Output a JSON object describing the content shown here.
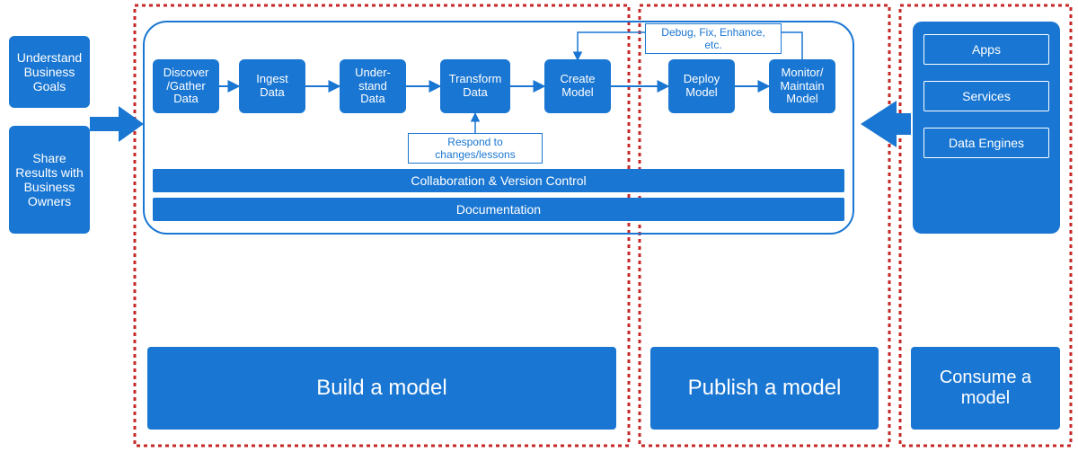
{
  "colors": {
    "primary": "#1976d2",
    "dashed": "#c62828"
  },
  "left": {
    "understand_goals": "Understand Business Goals",
    "share_results": "Share Results with Business Owners"
  },
  "process": {
    "steps": [
      "Discover /Gather Data",
      "Ingest Data",
      "Under-stand Data",
      "Transform Data",
      "Create Model",
      "Deploy Model",
      "Monitor/ Maintain Model"
    ],
    "feedback_top": "Debug, Fix, Enhance, etc.",
    "feedback_bottom": "Respond to changes/lessons"
  },
  "bars": {
    "collab": "Collaboration & Version Control",
    "docs": "Documentation"
  },
  "phases": {
    "build": "Build a model",
    "publish": "Publish a model",
    "consume": "Consume a model"
  },
  "consumers": {
    "apps": "Apps",
    "services": "Services",
    "engines": "Data Engines"
  }
}
